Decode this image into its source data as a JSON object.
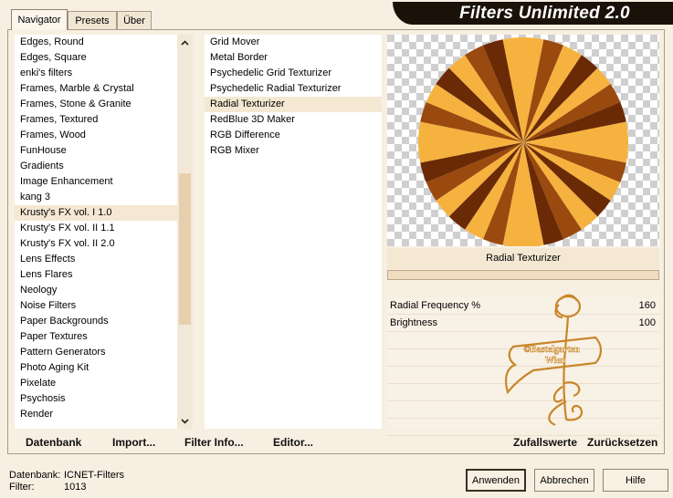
{
  "window": {
    "title": "Filters Unlimited 2.0"
  },
  "tabs": [
    {
      "label": "Navigator",
      "active": true
    },
    {
      "label": "Presets",
      "active": false
    },
    {
      "label": "Über",
      "active": false
    }
  ],
  "categories": [
    "Edges, Round",
    "Edges, Square",
    "enki's filters",
    "Frames, Marble & Crystal",
    "Frames, Stone & Granite",
    "Frames, Textured",
    "Frames, Wood",
    "FunHouse",
    "Gradients",
    "Image Enhancement",
    "kang 3",
    "Krusty's FX vol. I 1.0",
    "Krusty's FX vol. II 1.1",
    "Krusty's FX vol. II 2.0",
    "Lens Effects",
    "Lens Flares",
    "Neology",
    "Noise Filters",
    "Paper Backgrounds",
    "Paper Textures",
    "Pattern Generators",
    "Photo Aging Kit",
    "Pixelate",
    "Psychosis",
    "Render"
  ],
  "selected_category": "Krusty's FX vol. I 1.0",
  "filters": [
    "Grid Mover",
    "Metal Border",
    "Psychedelic Grid Texturizer",
    "Psychedelic Radial Texturizer",
    "Radial Texturizer",
    "RedBlue 3D Maker",
    "RGB Difference",
    "RGB Mixer"
  ],
  "selected_filter": "Radial Texturizer",
  "preview": {
    "filter_name": "Radial Texturizer",
    "colors": {
      "dark": "#6b2a06",
      "mid": "#9a4a0e",
      "light": "#f6b23f"
    }
  },
  "params": [
    {
      "label": "Radial Frequency %",
      "value": "160"
    },
    {
      "label": "Brightness",
      "value": "100"
    }
  ],
  "watermark": {
    "line1": "©Bastelgarten",
    "line2": "Wien"
  },
  "toolbar": {
    "datenbank": "Datenbank",
    "import": "Import...",
    "filter_info": "Filter Info...",
    "editor": "Editor...",
    "random": "Zufallswerte",
    "reset": "Zurücksetzen"
  },
  "status": {
    "db_label": "Datenbank:",
    "db_value": "ICNET-Filters",
    "filter_label": "Filter:",
    "filter_value": "1013"
  },
  "buttons": {
    "apply": "Anwenden",
    "cancel": "Abbrechen",
    "help": "Hilfe"
  }
}
